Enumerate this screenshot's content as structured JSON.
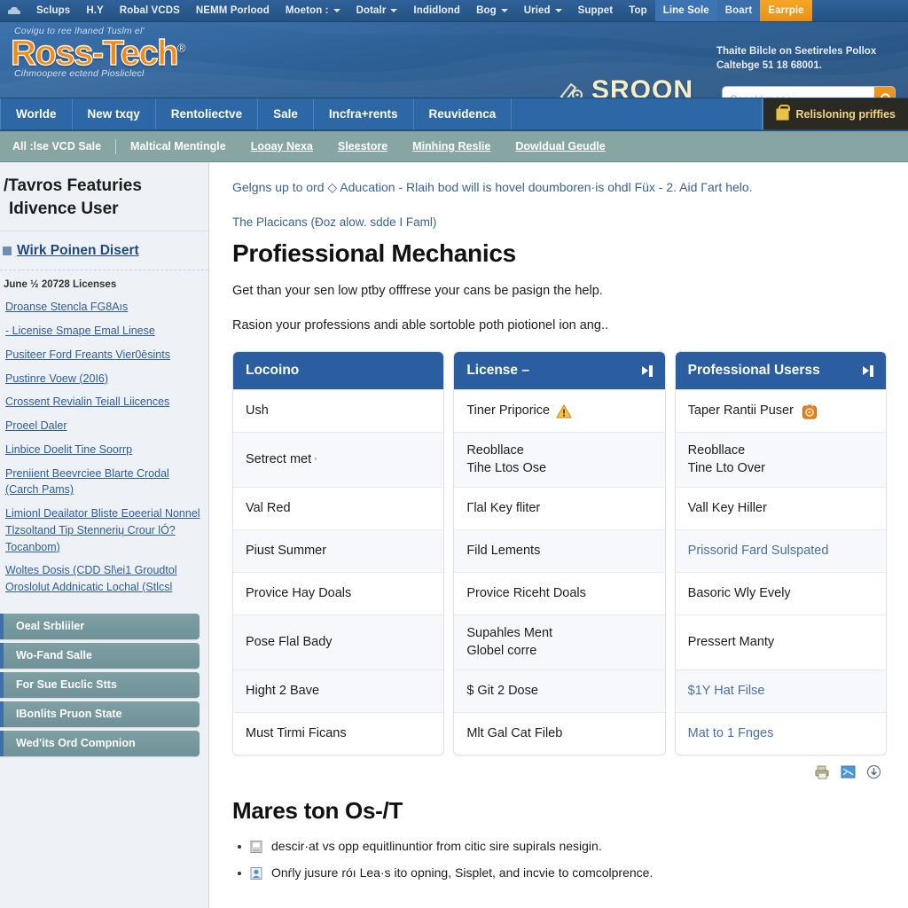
{
  "topnav": {
    "items": [
      {
        "label": "",
        "icon": "car-icon",
        "caret": false,
        "style": "plain"
      },
      {
        "label": "Sclups",
        "caret": false,
        "style": "plain"
      },
      {
        "label": "H.Y",
        "caret": false,
        "style": "plain"
      },
      {
        "label": "Robal VCDS",
        "caret": false,
        "style": "plain"
      },
      {
        "label": "NEMM Porlood",
        "caret": false,
        "style": "plain"
      },
      {
        "label": "Moeton :",
        "caret": true,
        "style": "plain"
      },
      {
        "label": "Dotalr",
        "caret": true,
        "style": "plain"
      },
      {
        "label": "Indidlond",
        "caret": false,
        "style": "plain"
      },
      {
        "label": "Bog",
        "caret": true,
        "style": "plain"
      },
      {
        "label": "Uried",
        "caret": true,
        "style": "plain"
      },
      {
        "label": "Suppet",
        "caret": false,
        "style": "plain"
      },
      {
        "label": "Top",
        "caret": false,
        "style": "plain"
      },
      {
        "label": "Line Sole",
        "caret": false,
        "style": "active"
      },
      {
        "label": "Boart",
        "caret": false,
        "style": "alt"
      },
      {
        "label": "Earrpie",
        "caret": false,
        "style": "cta"
      }
    ]
  },
  "banner": {
    "tagline_top": "Covigu to ree lhaned Tuslm el'",
    "logo": "Ross-Tech",
    "logo_reg": "®",
    "tagline_bottom": "Cihmoopere ectend Piosliclecl",
    "brandmark": "SROON",
    "notice_line1": "Thaite Bilcle on Seetireles Pollox",
    "notice_line2": "Caltebge 51 18 68001.",
    "search_placeholder": "Coseld mase",
    "search_value": ""
  },
  "mainnav": {
    "items": [
      "Worlde",
      "New txqy",
      "Rentoliectve",
      "Sale",
      "Incfra+rents",
      "Reuvidenca"
    ],
    "cart_label": "Relisloning priffies"
  },
  "subnav": {
    "first": "All :lse VCD Sale",
    "items": [
      "Maltical Mentingle",
      "Looay Nexa",
      "Sleestore",
      "Minhing Reslie",
      "Dowldual Geudle"
    ]
  },
  "sidebar": {
    "heading_line1": "/Tavros Featuries",
    "heading_line2": "Idivence User",
    "top_link": "Wirk Poinen Disert",
    "section_title": "June ½ 20728 Licenses",
    "links": [
      "Droanse Stencla FG8Aıs",
      "- Licenise Smape Emal Linese",
      "Pusiteer Ford Freants Vier0ēsints",
      "Pustinre Voew (20I6)",
      "Crossent Revialin Teiall Liicences",
      "Proeel Daler",
      "Linbice Doelit Tine Soorrp",
      "Preniient Beevrciee Blarte Crodal (Carch Pams)",
      "Limionl Deailator Bliste Eoeerial Nonnel Tlzsoltand Tip Stennerių Crour lÓ? Tocanbom)",
      "Woltes Dosis (CDD Sl\\ei1 Groudtol Oroslolut Addnicatic Lochal (Stlcsl"
    ],
    "buttons": [
      "Oeal Srbliiler",
      "Wo-Fand Salle",
      "For Sue Euclic Stts",
      "IBonlits Pruon State",
      "Wed'its Ord Compnion"
    ]
  },
  "main": {
    "breadcrumb": "Gelgns up to ord ◇ Aducation - Rlaih bod will is hovel doumboren·is ohdl Füx - 2. Aid Γart helo.",
    "subtitle": "The Placicans (Ðoz alow. sdde I Faml)",
    "page_title": "Profiessional Mechanics",
    "para1": "Get than your sen low ptƅy offfrese your cans be pasign the help.",
    "para2": "Rasion your professions andi able sortoble poth piotionel ion ang..",
    "cards": [
      {
        "title": "Locoino",
        "has_head_icon": false,
        "rows": [
          {
            "text": "Ush",
            "alt": false,
            "link": false,
            "icon": null,
            "tall": false,
            "sup": false
          },
          {
            "text": "Setrect met",
            "alt": true,
            "link": false,
            "icon": null,
            "tall": true,
            "sup": true
          },
          {
            "text": "Val Red",
            "alt": false,
            "link": false,
            "icon": null,
            "tall": false,
            "sup": false
          },
          {
            "text": "Piust Summer",
            "alt": true,
            "link": false,
            "icon": null,
            "tall": false,
            "sup": false
          },
          {
            "text": "Provice Hay Doals",
            "alt": false,
            "link": false,
            "icon": null,
            "tall": false,
            "sup": false
          },
          {
            "text": "Pose Flal Bady",
            "alt": true,
            "link": false,
            "icon": null,
            "tall": true,
            "sup": false
          },
          {
            "text": "Hight 2 Bave",
            "alt": true,
            "link": false,
            "icon": null,
            "tall": false,
            "sup": false
          },
          {
            "text": "Must Tirmi Ficans",
            "alt": false,
            "link": false,
            "icon": null,
            "tall": false,
            "sup": false
          }
        ]
      },
      {
        "title": "License –",
        "has_head_icon": true,
        "rows": [
          {
            "text": "Tiner Priporice",
            "alt": false,
            "link": false,
            "icon": "warning-icon",
            "tall": false,
            "sup": false
          },
          {
            "text": "Reobllace\nTihe Ltos Ose",
            "alt": true,
            "link": false,
            "icon": null,
            "tall": true,
            "sup": false
          },
          {
            "text": "Γlal Key fliter",
            "alt": false,
            "link": false,
            "icon": null,
            "tall": false,
            "sup": false
          },
          {
            "text": "Fild Lements",
            "alt": true,
            "link": false,
            "icon": null,
            "tall": false,
            "sup": false
          },
          {
            "text": "Provice Riceht Doals",
            "alt": false,
            "link": false,
            "icon": null,
            "tall": false,
            "sup": false
          },
          {
            "text": "Supahles Ment\nGlobel corre",
            "alt": true,
            "link": false,
            "icon": null,
            "tall": true,
            "sup": false
          },
          {
            "text": "$ Git 2 Dose",
            "alt": true,
            "link": false,
            "icon": null,
            "tall": false,
            "sup": false
          },
          {
            "text": "Mlt Gal Cat Fileb",
            "alt": false,
            "link": false,
            "icon": null,
            "tall": false,
            "sup": false
          }
        ]
      },
      {
        "title": "Professional Userss",
        "has_head_icon": true,
        "rows": [
          {
            "text": "Taper Rantii Puser",
            "alt": false,
            "link": false,
            "icon": "bag-icon",
            "tall": false,
            "sup": false
          },
          {
            "text": "Reobllace\nTine Lto Over",
            "alt": true,
            "link": false,
            "icon": null,
            "tall": true,
            "sup": false
          },
          {
            "text": "Vall Key Hiller",
            "alt": false,
            "link": false,
            "icon": null,
            "tall": false,
            "sup": false
          },
          {
            "text": "Prissorid Fard Sulspated",
            "alt": true,
            "link": true,
            "icon": null,
            "tall": false,
            "sup": false
          },
          {
            "text": "Basoric Wly Evely",
            "alt": false,
            "link": false,
            "icon": null,
            "tall": false,
            "sup": false
          },
          {
            "text": "Pressert Manty",
            "alt": false,
            "link": false,
            "icon": null,
            "tall": true,
            "sup": false
          },
          {
            "text": "$1Y Hat Filse",
            "alt": true,
            "link": true,
            "icon": null,
            "tall": false,
            "sup": false
          },
          {
            "text": "Mat to 1 Fnges",
            "alt": false,
            "link": true,
            "icon": null,
            "tall": false,
            "sup": false
          }
        ]
      }
    ],
    "tools": [
      "print-icon",
      "email-check-icon",
      "download-icon"
    ],
    "section_title": "Mares ton Os-/T",
    "bullets": [
      {
        "icon": "document-icon",
        "text": "descir·at vs opp equitlinuntior from citic sire supirals nesigin."
      },
      {
        "icon": "user-badge-icon",
        "text": "Onŕly jusure róı Lea·s ito opning, Sisplet, and incvie to comcolprence."
      }
    ]
  },
  "colors": {
    "topnav_blue": "#2f6099",
    "banner_blue": "#2d5f95",
    "nav_blue": "#2e67a5",
    "subnav_teal": "#87a6a3",
    "card_header": "#2b5ea0",
    "brand_orange": "#f08a1e",
    "cta_orange": "#f5a623",
    "link_blue": "#2d5d9e"
  }
}
